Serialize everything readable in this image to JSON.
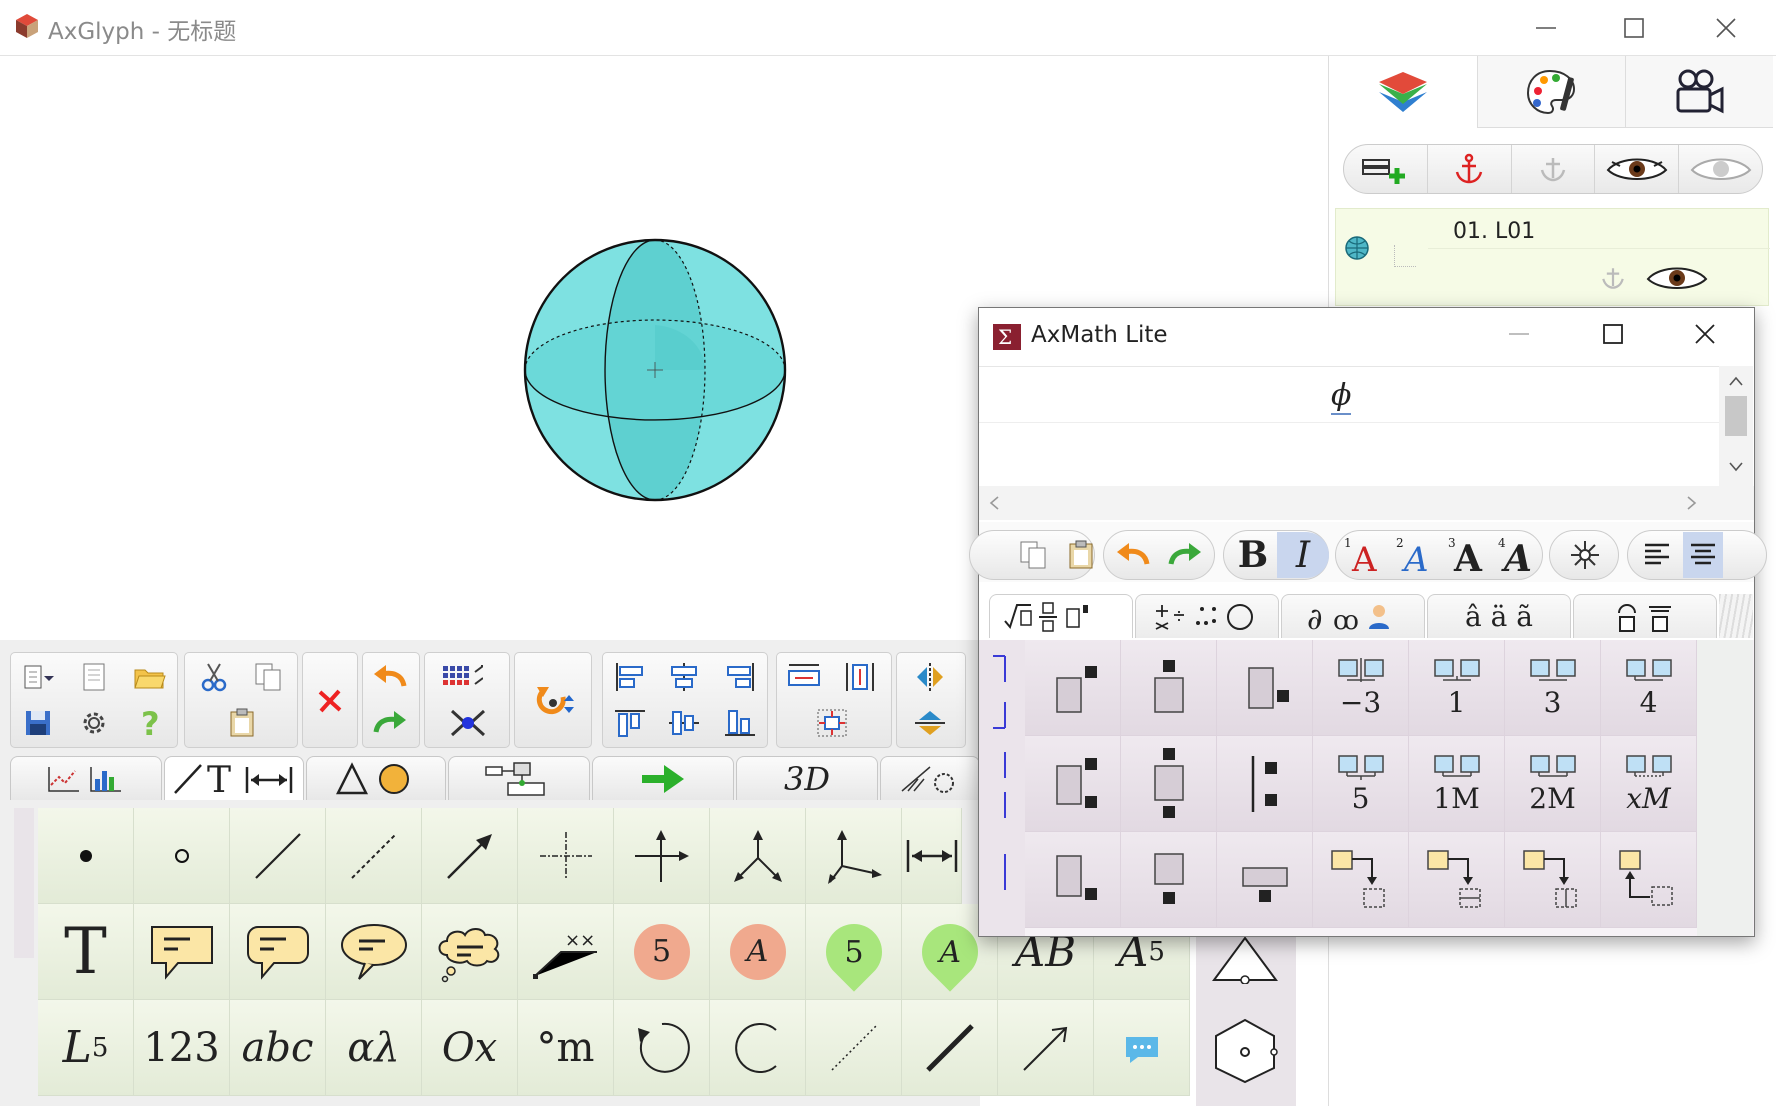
{
  "window": {
    "app_name": "AxGlyph",
    "separator": " - ",
    "doc_title": "无标题"
  },
  "right_panel": {
    "tabs": [
      "layers-icon",
      "palette-icon",
      "camera-icon"
    ],
    "tools": [
      "add-layer-icon",
      "anchor-icon",
      "anchor-disabled-icon",
      "eye-open-icon",
      "eye-hidden-icon"
    ],
    "layer": {
      "name": "01. L01"
    }
  },
  "bottom_tabs": [
    "chart-tab",
    "line-text-dimension-tab",
    "shapes-tab",
    "flowchart-tab",
    "arrows-tab",
    "3d-tab",
    "other-tab"
  ],
  "bottom_tab_3d_label": "3D",
  "palette": {
    "row2": {
      "text_tool": "T",
      "badge_5": "5",
      "badge_a": "A",
      "marker_5": "5",
      "marker_a": "A",
      "ab": "AB",
      "a_sub_main": "A",
      "a_sub": "5"
    },
    "row3": {
      "l_sub_main": "L",
      "l_sub": "5",
      "num": "123",
      "abc": "abc",
      "greek": "αλ",
      "ox": "Ox",
      "deg_m": "°m"
    }
  },
  "axmath": {
    "title": "AxMath Lite",
    "formula": "ϕ",
    "toolbar": {
      "bold": "B",
      "italic": "I"
    },
    "tabs": [
      "√□ structures",
      "operators",
      "∂ symbols",
      "â ä ã",
      "accents"
    ],
    "tab_labels": {
      "t3": "â ä ã"
    },
    "grid": {
      "r1": [
        "",
        "",
        "",
        "−3",
        "1",
        "3",
        "4"
      ],
      "r2": [
        "",
        "",
        "",
        "5",
        "1M",
        "2M",
        "xM"
      ]
    }
  },
  "colors": {
    "sphere": "#6ad8d8",
    "toolbar_green": "#e6eeda",
    "math_pink": "#e8e0e8"
  }
}
